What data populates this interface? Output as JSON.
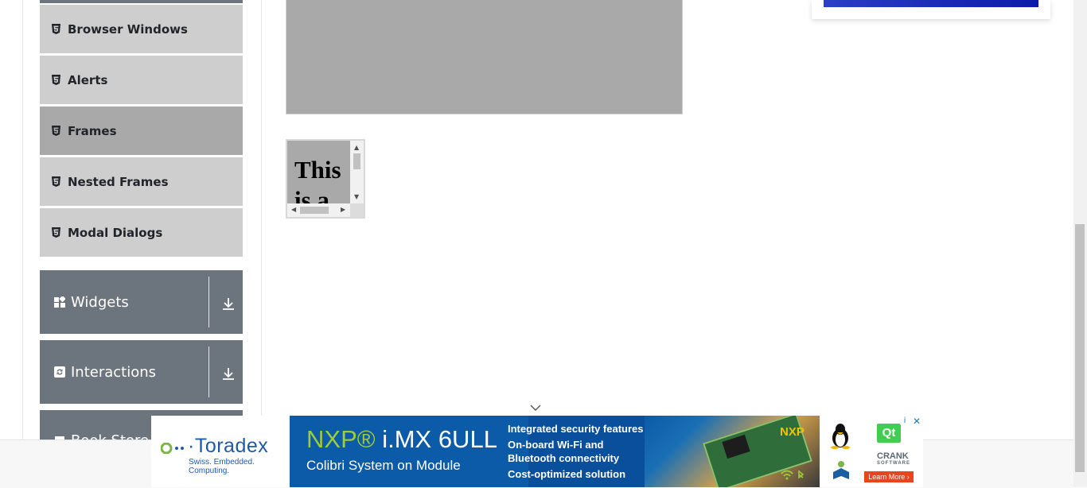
{
  "sidebar": {
    "items": [
      {
        "label": "Browser Windows",
        "icon": "html5-icon",
        "active": false
      },
      {
        "label": "Alerts",
        "icon": "html5-icon",
        "active": false
      },
      {
        "label": "Frames",
        "icon": "html5-icon",
        "active": true
      },
      {
        "label": "Nested Frames",
        "icon": "html5-icon",
        "active": false
      },
      {
        "label": "Modal Dialogs",
        "icon": "html5-icon",
        "active": false
      }
    ],
    "groups": [
      {
        "label": "Widgets",
        "icon": "widgets-icon"
      },
      {
        "label": "Interactions",
        "icon": "interactions-icon"
      },
      {
        "label": "Book Store",
        "icon": "book-store-icon"
      }
    ]
  },
  "main": {
    "small_frame_text": "This is a sample page"
  },
  "ad": {
    "brand": "·Toradex",
    "brand_tagline": "Swiss. Embedded. Computing.",
    "headline_accent": "NXP®",
    "headline": " i.MX 6ULL",
    "subheadline": "Colibri System on Module",
    "features": [
      "Integrated security features",
      "On-board Wi-Fi and",
      "Bluetooth connectivity",
      "Cost-optimized solution"
    ],
    "partner_nxp": "NXP",
    "partner_qt": "Qt",
    "partner_crank": "CRANK",
    "partner_crank_sub": "SOFTWARE",
    "cta": "Learn More ›",
    "close_label": "✕",
    "info_label": "i"
  },
  "colors": {
    "sidebar_item_bg": "#cecece",
    "sidebar_item_active_bg": "#a9a9a9",
    "group_bg": "#6c757d",
    "frame_bg": "#a9a9a9"
  }
}
